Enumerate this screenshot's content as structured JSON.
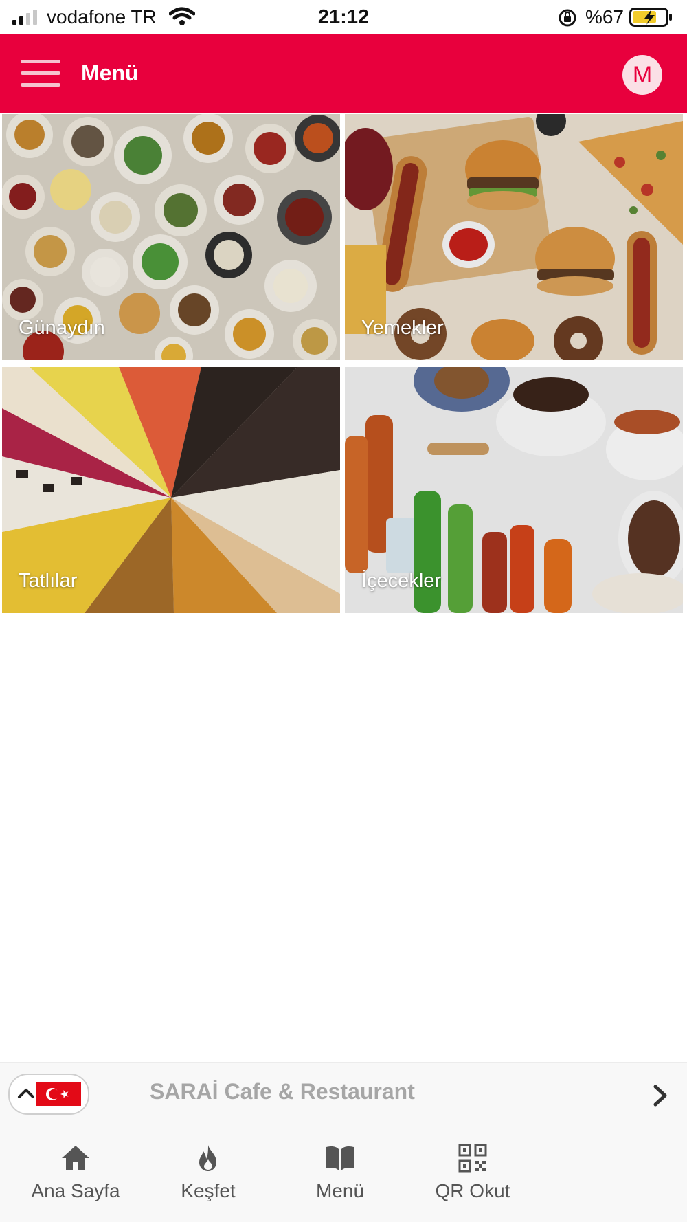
{
  "status_bar": {
    "carrier": "vodafone TR",
    "time": "21:12",
    "battery_percent": "%67"
  },
  "header": {
    "title": "Menü",
    "avatar_letter": "M",
    "accent_color": "#e8003d"
  },
  "categories": [
    {
      "label": "Günaydın"
    },
    {
      "label": "Yemekler"
    },
    {
      "label": "Tatlılar"
    },
    {
      "label": "İçecekler"
    }
  ],
  "restaurant_bar": {
    "name": "SARAİ Cafe & Restaurant",
    "language_flag": "turkey-flag-icon"
  },
  "bottom_nav": {
    "items": [
      {
        "label": "Ana Sayfa",
        "icon": "home-icon"
      },
      {
        "label": "Keşfet",
        "icon": "fire-icon"
      },
      {
        "label": "Menü",
        "icon": "book-icon"
      },
      {
        "label": "QR Okut",
        "icon": "qr-code-icon"
      }
    ]
  }
}
